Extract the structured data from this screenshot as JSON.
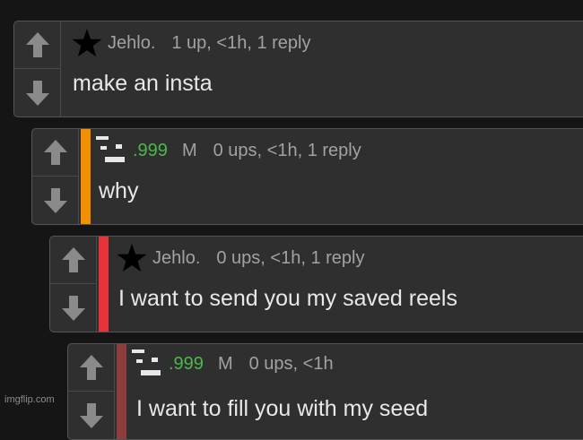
{
  "colors": {
    "background": "#151515",
    "panel": "#2f2f2f",
    "username_green": "#4cb84c",
    "thread_orange": "#f39000",
    "thread_red": "#e8323a",
    "thread_dark_red": "#8e3c3c"
  },
  "icons": {
    "upvote": "arrow-up-icon",
    "downvote": "arrow-down-icon",
    "star_avatar": "star-icon",
    "pixel_avatar": "pixel-avatar-icon"
  },
  "comments": [
    {
      "username": "Jehlo.",
      "badge": "",
      "meta": "1 up, <1h, 1 reply",
      "text": "make an insta"
    },
    {
      "username": ".999",
      "badge": "M",
      "meta": "0 ups, <1h, 1 reply",
      "text": "why"
    },
    {
      "username": "Jehlo.",
      "badge": "",
      "meta": "0 ups, <1h, 1 reply",
      "text": "I want to send you my saved reels"
    },
    {
      "username": ".999",
      "badge": "M",
      "meta": "0 ups, <1h",
      "text": "I want to fill you with my seed"
    }
  ],
  "watermark": "imgflip.com"
}
